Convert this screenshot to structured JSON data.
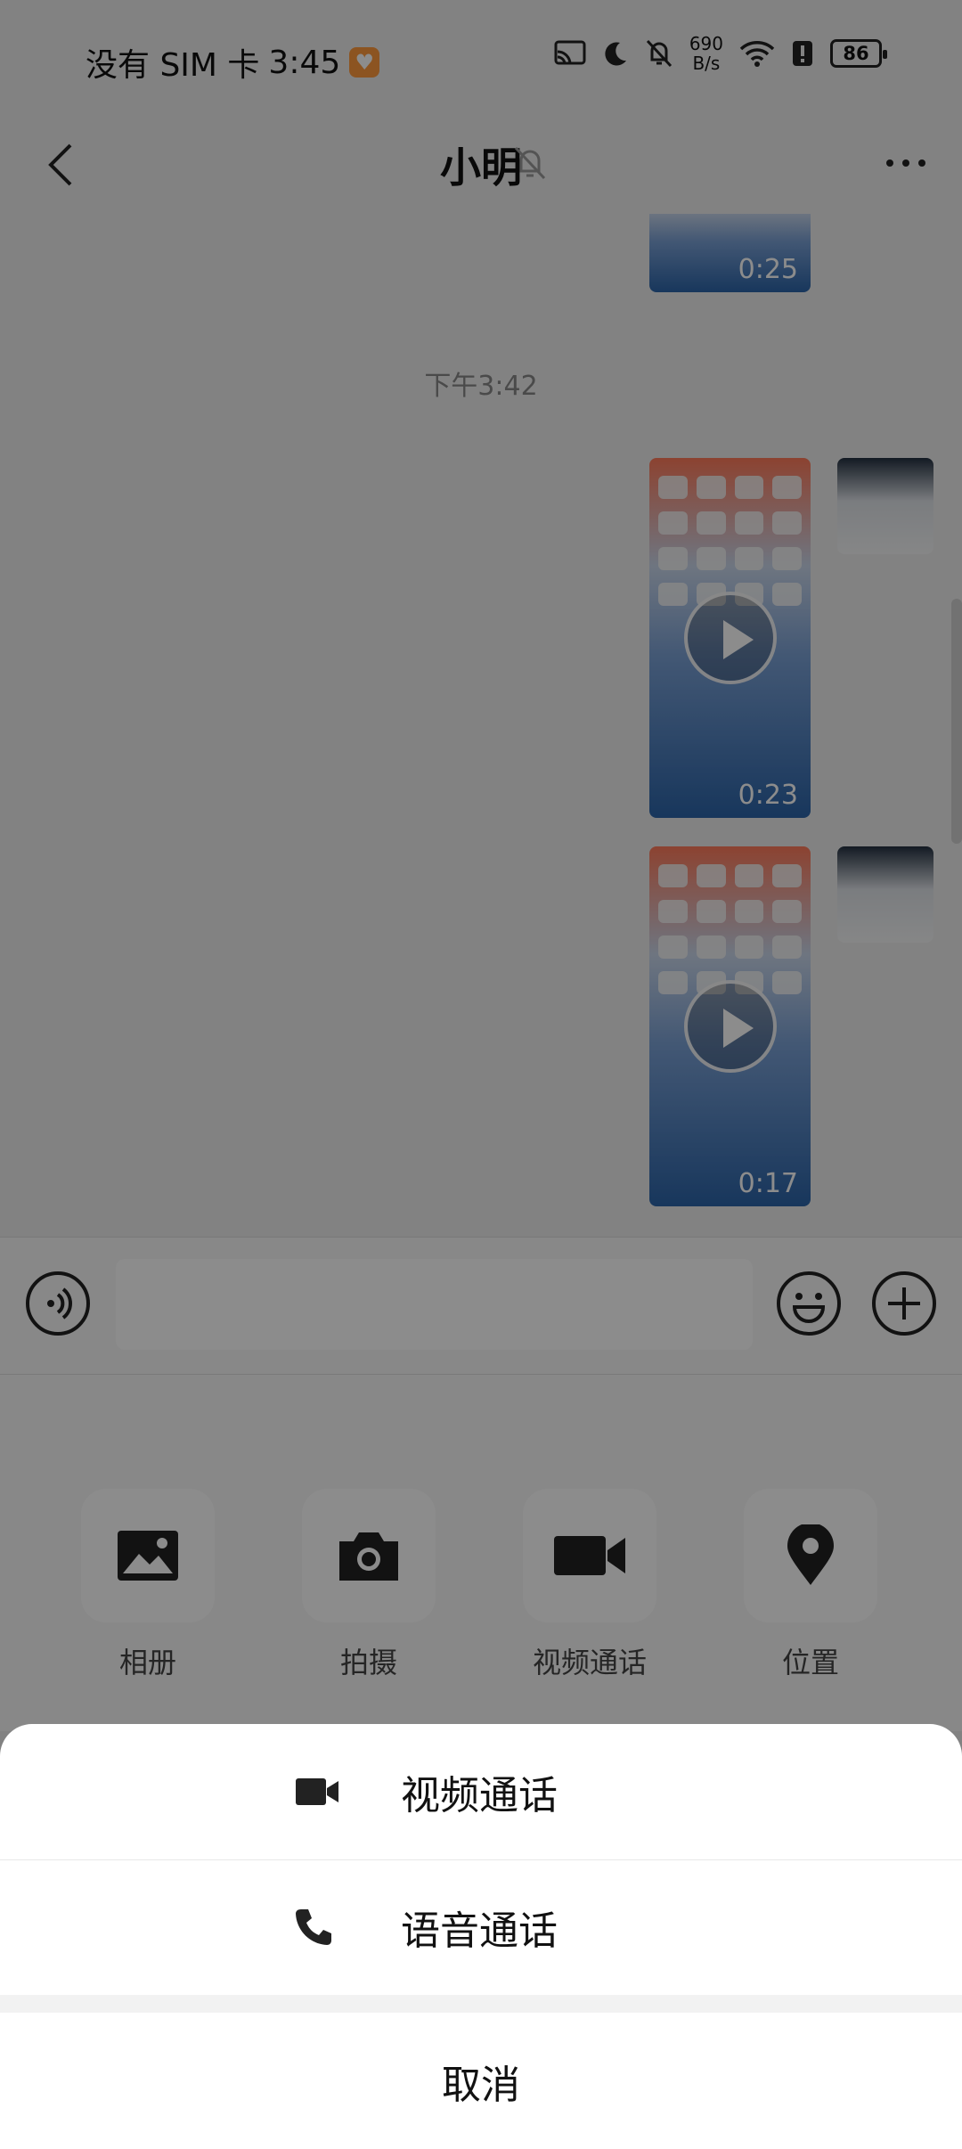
{
  "status_bar": {
    "carrier": "没有 SIM 卡",
    "time": "3:45",
    "speed_value": "690",
    "speed_unit": "B/s",
    "battery": "86"
  },
  "header": {
    "title": "小明"
  },
  "chat": {
    "time_separator": "下午3:42",
    "messages": [
      {
        "type": "video",
        "duration": "0:25"
      },
      {
        "type": "video",
        "duration": "0:23"
      },
      {
        "type": "video",
        "duration": "0:17"
      }
    ]
  },
  "input_bar": {
    "placeholder": ""
  },
  "panel": {
    "items": [
      {
        "label": "相册",
        "icon": "image-icon"
      },
      {
        "label": "拍摄",
        "icon": "camera-icon"
      },
      {
        "label": "视频通话",
        "icon": "video-icon"
      },
      {
        "label": "位置",
        "icon": "location-icon"
      }
    ]
  },
  "sheet": {
    "options": [
      {
        "label": "视频通话",
        "icon": "video-camera-icon"
      },
      {
        "label": "语音通话",
        "icon": "phone-icon"
      }
    ],
    "cancel": "取消"
  },
  "colors": {
    "background": "#ededed",
    "overlay": "rgba(0,0,0,0.45)",
    "sheet": "#ffffff"
  }
}
